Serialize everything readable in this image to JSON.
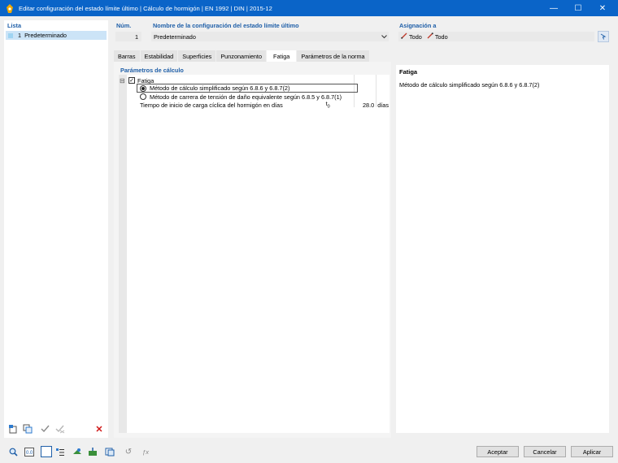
{
  "window": {
    "title": "Editar configuración del estado límite último | Cálculo de hormigón | EN 1992 | DIN | 2015-12",
    "minimize": "—",
    "maximize": "☐",
    "close": "✕"
  },
  "list": {
    "label": "Lista",
    "items": [
      {
        "number": "1",
        "name": "Predeterminado"
      }
    ]
  },
  "num": {
    "label": "Núm.",
    "value": "1"
  },
  "config_name": {
    "label": "Nombre de la configuración del estado límite último",
    "value": "Predeterminado"
  },
  "assignment": {
    "label": "Asignación a",
    "item1": "Todo",
    "item2": "Todo"
  },
  "tabs": [
    {
      "label": "Barras",
      "active": false
    },
    {
      "label": "Estabilidad",
      "active": false
    },
    {
      "label": "Superficies",
      "active": false
    },
    {
      "label": "Punzonamiento",
      "active": false
    },
    {
      "label": "Fatiga",
      "active": true
    },
    {
      "label": "Parámetros de la norma",
      "active": false
    }
  ],
  "params": {
    "label": "Parámetros de cálculo",
    "group": "Fatiga",
    "expander": "⊟",
    "check_mark": "✓",
    "option1": "Método de cálculo simplificado según 6.8.6 y 6.8.7(2)",
    "option2": "Método de carrera de tensión de daño equivalente según 6.8.5 y 6.8.7(1)",
    "time_label": "Tiempo de inicio de carga cíclica del hormigón en días",
    "time_symbol": "t",
    "time_sub": "0",
    "time_value": "28.0",
    "time_unit": "días"
  },
  "info": {
    "title": "Fatiga",
    "text": "Método de cálculo simplificado según 6.8.6 y 6.8.7(2)"
  },
  "buttons": {
    "accept": "Aceptar",
    "cancel": "Cancelar",
    "apply": "Aplicar"
  },
  "icons": {
    "delete_glyph": "✕",
    "history_glyph": "↺",
    "formula_glyph": "ƒx"
  },
  "colors": {
    "titlebar": "#0a64c8",
    "accent": "#1f5fa8",
    "selection": "#cce4f7"
  }
}
